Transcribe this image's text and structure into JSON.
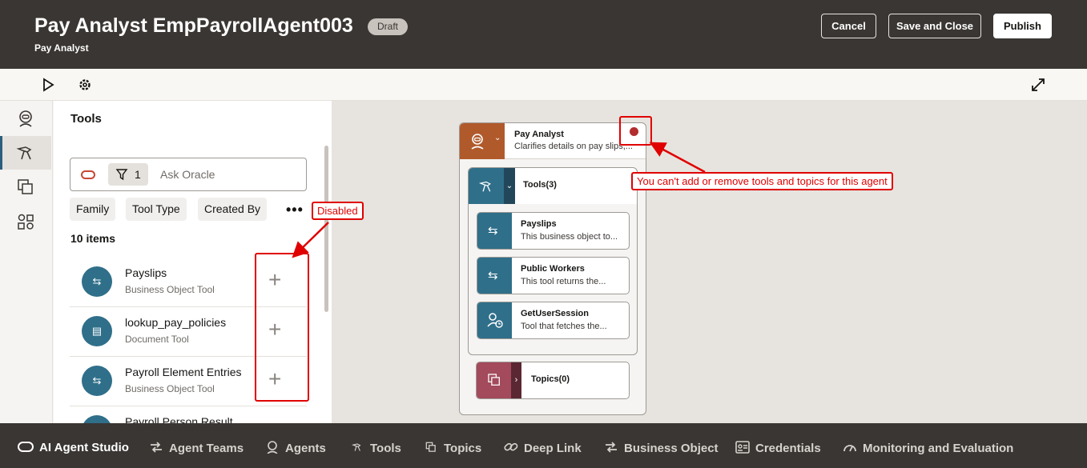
{
  "header": {
    "title": "Pay Analyst EmpPayrollAgent003",
    "subtitle": "Pay Analyst",
    "badge": "Draft",
    "buttons": {
      "cancel": "Cancel",
      "save_close": "Save and Close",
      "publish": "Publish"
    }
  },
  "panel": {
    "title": "Tools",
    "search": {
      "filter_count": "1",
      "placeholder": "Ask Oracle"
    },
    "filters": [
      "Family",
      "Tool Type",
      "Created By"
    ],
    "more": "•••",
    "item_count": "10 items",
    "items": [
      {
        "name": "Payslips",
        "type": "Business Object Tool"
      },
      {
        "name": "lookup_pay_policies",
        "type": "Document Tool"
      },
      {
        "name": "Payroll Element Entries",
        "type": "Business Object Tool"
      },
      {
        "name": "Payroll Person Result",
        "type": ""
      }
    ],
    "add_symbol": "+"
  },
  "canvas": {
    "agent": {
      "name": "Pay Analyst",
      "description": "Clarifies details on pay slips,..."
    },
    "tools_header": "Tools(3)",
    "tools": [
      {
        "name": "Payslips",
        "description": "This business object to..."
      },
      {
        "name": "Public Workers",
        "description": "This tool returns the..."
      },
      {
        "name": "GetUserSession",
        "description": "Tool that fetches the..."
      }
    ],
    "topics_header": "Topics(0)"
  },
  "annotations": {
    "disabled": "Disabled",
    "cannot_add": "You can't add or remove tools and topics for this agent"
  },
  "bottom_nav": [
    {
      "label": "AI Agent Studio",
      "icon": "oracle-icon"
    },
    {
      "label": "Agent Teams",
      "icon": "agent-teams-icon"
    },
    {
      "label": "Agents",
      "icon": "agents-icon"
    },
    {
      "label": "Tools",
      "icon": "tools-icon"
    },
    {
      "label": "Topics",
      "icon": "topics-icon"
    },
    {
      "label": "Deep Link",
      "icon": "link-icon"
    },
    {
      "label": "Business Object",
      "icon": "business-object-icon"
    },
    {
      "label": "Credentials",
      "icon": "credentials-icon"
    },
    {
      "label": "Monitoring and Evaluation",
      "icon": "monitoring-icon"
    }
  ],
  "colors": {
    "header_bg": "#3a3633",
    "accent_teal": "#2f6f8a",
    "annotation_red": "#e00000",
    "agent_orange": "#b05a2c",
    "topics_rose": "#a34a5c"
  }
}
